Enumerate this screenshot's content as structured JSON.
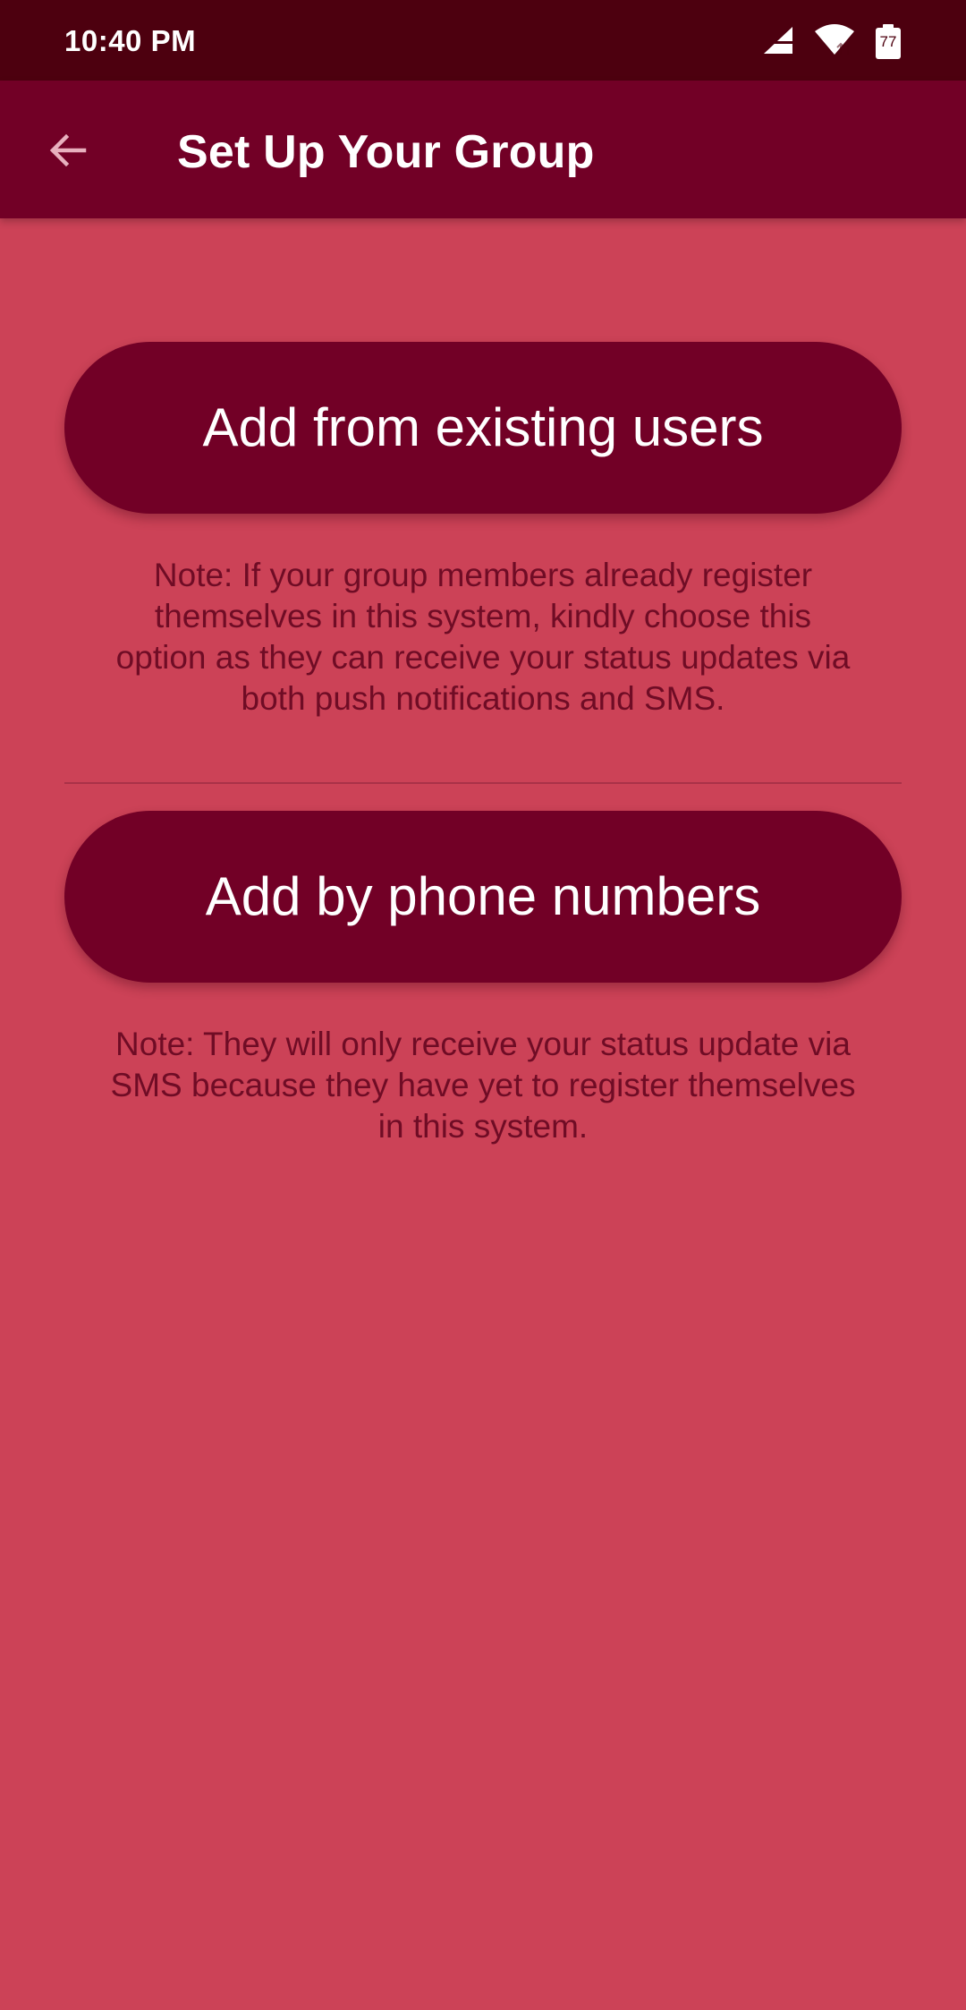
{
  "status_bar": {
    "time": "10:40 PM",
    "battery_level": "77",
    "icons": [
      "signal-icon",
      "wifi-icon",
      "battery-icon"
    ]
  },
  "app_bar": {
    "title": "Set Up Your Group",
    "back_icon": "arrow-left-icon"
  },
  "options": {
    "existing_users": {
      "label": "Add from existing users",
      "note": "Note: If your group members already register themselves in this system, kindly choose this option as they can receive your status updates via both push notifications and SMS."
    },
    "phone_numbers": {
      "label": "Add by phone numbers",
      "note": "Note: They will only receive your status update via SMS because they have yet to register themselves in this system."
    }
  },
  "colors": {
    "status_bar": "#4d000f",
    "app_bar": "#720026",
    "background": "#cc4257",
    "button": "#720026",
    "note_text": "#6f0c25"
  }
}
